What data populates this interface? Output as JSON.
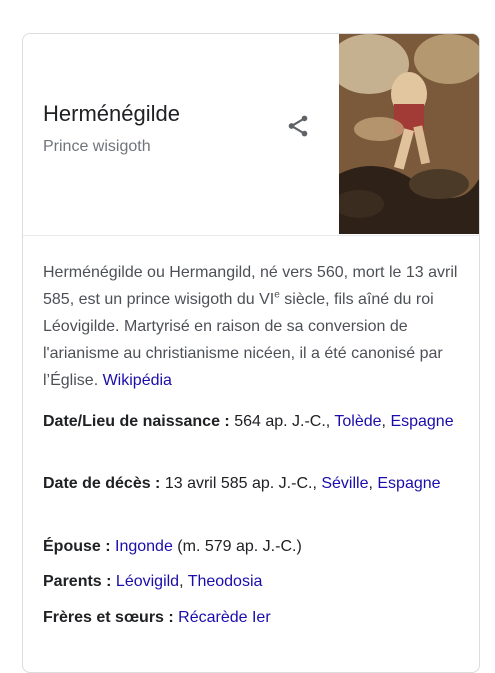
{
  "entity": {
    "title": "Herménégilde",
    "subtitle": "Prince wisigoth"
  },
  "icons": {
    "share": "share-icon"
  },
  "description": {
    "part1": "Herménégilde ou Hermangild, né vers 560, mort le 13 avril 585, est un prince wisigoth du VI",
    "sup": "e",
    "part2": " siècle, fils aîné du roi Léovigilde. Martyrisé en raison de sa conversion de l'arianisme au christianisme nicéen, il a été canonisé par l’Église. ",
    "source_link": "Wikipédia"
  },
  "facts": {
    "birth": {
      "label": "Date/Lieu de naissance : ",
      "text": "564 ap. J.-C., ",
      "link1": "Tolède",
      "sep": ", ",
      "link2": "Espagne"
    },
    "death": {
      "label": "Date de décès : ",
      "text": "13 avril 585 ap. J.-C., ",
      "link1": "Séville",
      "sep": ", ",
      "link2": "Espagne"
    },
    "spouse": {
      "label": "Épouse : ",
      "link1": "Ingonde",
      "text": " (m. 579 ap. J.-C.)"
    },
    "parents": {
      "label": "Parents : ",
      "link1": "Léovigild",
      "sep": ", ",
      "link2": "Theodosia"
    },
    "siblings": {
      "label": "Frères et sœurs : ",
      "link1": "Récarède Ier"
    }
  }
}
